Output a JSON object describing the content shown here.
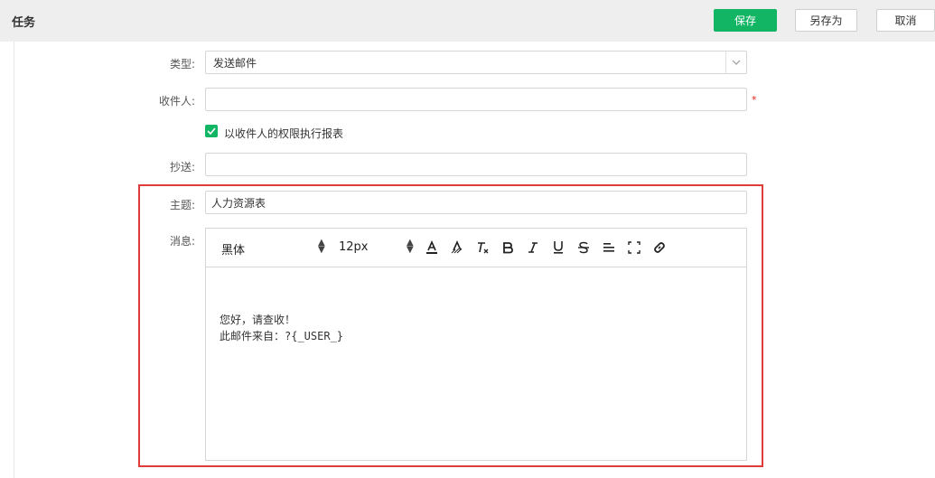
{
  "header": {
    "title": "任务",
    "save_label": "保存",
    "saveas_label": "另存为",
    "cancel_label": "取消"
  },
  "colors": {
    "accent": "#12b564",
    "highlight": "#e03c3c",
    "required": "#e02020"
  },
  "form": {
    "type_label": "类型:",
    "type_value": "发送邮件",
    "recipient_label": "收件人:",
    "recipient_value": "",
    "required_mark": "*",
    "permission_checkbox_label": "以收件人的权限执行报表",
    "permission_checked": true,
    "cc_label": "抄送:",
    "cc_value": "",
    "subject_label": "主题:",
    "subject_value": "人力资源表",
    "message_label": "消息:"
  },
  "editor": {
    "font_family": "黑体",
    "font_size": "12px",
    "toolbar_icons": [
      "font-color-icon",
      "background-color-icon",
      "clear-format-icon",
      "bold-icon",
      "italic-icon",
      "underline-icon",
      "strikethrough-icon",
      "align-icon",
      "fullscreen-icon",
      "link-icon"
    ],
    "content_line1": "您好，请查收！",
    "content_line2": "此邮件来自：?{_USER_}"
  }
}
